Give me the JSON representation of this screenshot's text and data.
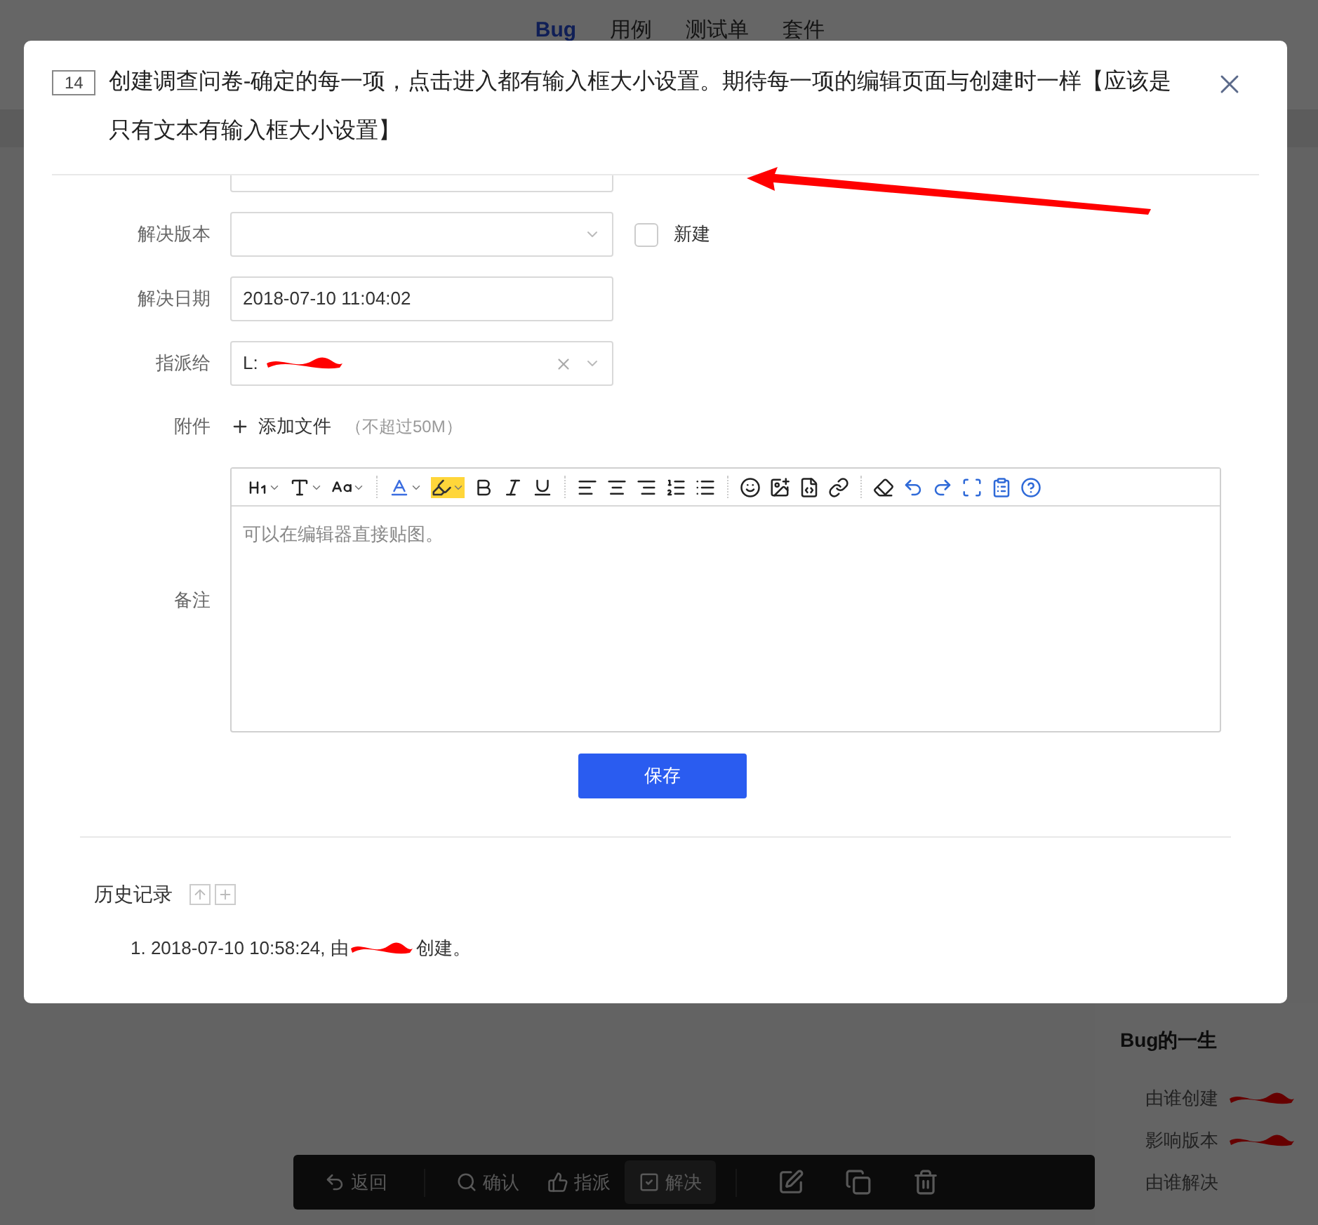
{
  "background": {
    "nav_tabs": [
      {
        "label": "Bug",
        "selected": true
      },
      {
        "label": "用例",
        "selected": false
      },
      {
        "label": "测试单",
        "selected": false
      },
      {
        "label": "套件",
        "selected": false
      }
    ],
    "lifecycle": {
      "title": "Bug的一生",
      "rows": [
        {
          "label": "由谁创建",
          "redacted": true
        },
        {
          "label": "影响版本",
          "redacted": true
        },
        {
          "label": "由谁解决",
          "redacted": false
        }
      ]
    },
    "toolbar": [
      {
        "label": "返回",
        "selected": false
      },
      {
        "label": "确认",
        "selected": false
      },
      {
        "label": "指派",
        "selected": false
      },
      {
        "label": "解决",
        "selected": true
      }
    ]
  },
  "dialog": {
    "id": "14",
    "title": "创建调查问卷-确定的每一项，点击进入都有输入框大小设置。期待每一项的编辑页面与创建时一样【应该是只有文本有输入框大小设置】",
    "fields": [
      {
        "kind": "text"
      },
      {
        "kind": "select",
        "label": "解决版本",
        "checkbox": {
          "label": "新建",
          "checked": false
        }
      },
      {
        "kind": "text",
        "label": "解决日期",
        "value": "2018-07-10 11:04:02"
      },
      {
        "kind": "select",
        "label": "指派给",
        "value": "L:",
        "redacted": true,
        "clearable": true
      },
      {
        "kind": "file",
        "label": "附件",
        "action": "添加文件",
        "hint": "（不超过50M）"
      },
      {
        "kind": "editor",
        "label": "备注",
        "placeholder": "可以在编辑器直接贴图。"
      }
    ],
    "save_button": "保存",
    "history": {
      "title": "历史记录",
      "entries": [
        {
          "before": "1. 2018-07-10 10:58:24, 由",
          "after": "创建。",
          "redacted": true
        }
      ]
    }
  }
}
